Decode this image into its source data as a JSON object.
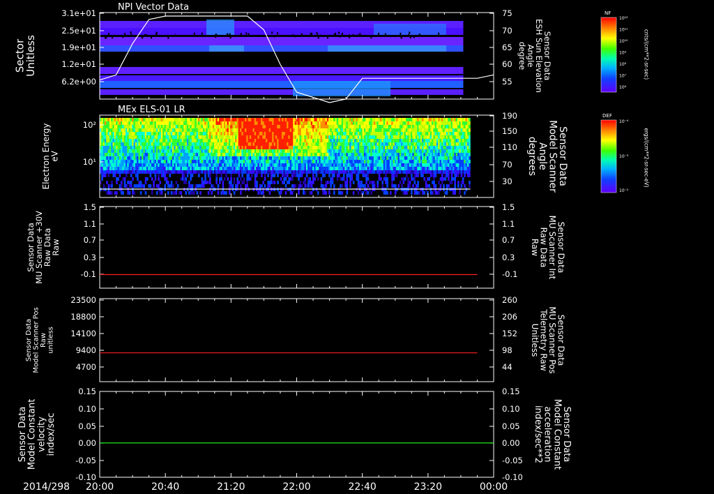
{
  "chart_data": [
    {
      "type": "heatmap",
      "title": "NPI Vector Data",
      "ylabel": "Sector Unitless",
      "yticks": [
        "3.1e+01",
        "2.5e+01",
        "1.9e+01",
        "1.2e+01",
        "6.2e+00"
      ],
      "right_ylabel": [
        "Sensor Data",
        "ESH Sun Elevation",
        "Angle",
        "degree"
      ],
      "right_yticks": [
        "75",
        "70",
        "65",
        "60",
        "55"
      ],
      "right_ylim": [
        50,
        75
      ],
      "colorbar": {
        "label": "NF",
        "units": "cnts/(cm**2-sr-sec)",
        "ticks": [
          "10¹²",
          "10¹¹",
          "10¹⁰",
          "10⁹",
          "10⁸",
          "10⁷",
          "10⁶"
        ]
      },
      "overlay_series": {
        "name": "ESH Sun Elevation Angle",
        "color": "#ffffff",
        "x": [
          "20:00",
          "20:10",
          "20:20",
          "20:30",
          "20:40",
          "20:50",
          "21:10",
          "21:30",
          "21:40",
          "21:50",
          "22:00",
          "22:20",
          "22:30",
          "22:40",
          "23:00",
          "23:30",
          "23:50",
          "24:00"
        ],
        "y": [
          55.5,
          57,
          66,
          73,
          74,
          74,
          74,
          74,
          70,
          60,
          52,
          49,
          50,
          56,
          56,
          56,
          56,
          57
        ]
      }
    },
    {
      "type": "heatmap",
      "title": "MEx ELS-01 LR",
      "ylabel": "Electron Energy eV",
      "yticks": [
        "10²",
        "10¹"
      ],
      "right_ylabel": [
        "Sensor Data",
        "Model Scanner",
        "Angle",
        "degrees"
      ],
      "right_yticks": [
        "190",
        "150",
        "110",
        "70",
        "30"
      ],
      "right_ylim": [
        0,
        190
      ],
      "colorbar": {
        "label": "DEF",
        "units": "ergs/(cm**2-sr-sec-eV)",
        "ticks": [
          "10⁻²",
          "10⁻³",
          "10⁻⁴"
        ]
      },
      "overlay_series": {
        "name": "Model Scanner Angle",
        "color": "#ffffff",
        "x": [
          "20:00",
          "23:50"
        ],
        "y": [
          10,
          10
        ]
      }
    },
    {
      "type": "line",
      "ylabel": [
        "Sensor Data",
        "MU Scanner +30V",
        "Raw Data",
        "Raw"
      ],
      "yticks": [
        "1.5",
        "1.1",
        "0.7",
        "0.3",
        "-0.1"
      ],
      "ylim": [
        -0.3,
        1.5
      ],
      "right_ylabel": [
        "Sensor Data",
        "MU Scanner Int",
        "Raw Data",
        "Raw"
      ],
      "right_yticks": [
        "1.5",
        "1.1",
        "0.7",
        "0.3",
        "-0.1"
      ],
      "series": [
        {
          "color": "#ff2020",
          "x": [
            "20:00",
            "23:50"
          ],
          "y": [
            0.0,
            0.0
          ]
        }
      ]
    },
    {
      "type": "line",
      "ylabel": [
        "Sensor Data",
        "Model Scanner Pos",
        "Raw",
        "unitless"
      ],
      "yticks": [
        "23500",
        "18800",
        "14100",
        "9400",
        "4700"
      ],
      "ylim": [
        0,
        23500
      ],
      "right_ylabel": [
        "Sensor Data",
        "MU Scanner Pos",
        "Telemetry Raw",
        "Unitless"
      ],
      "right_yticks": [
        "260",
        "206",
        "152",
        "98",
        "44"
      ],
      "series": [
        {
          "color": "#ff2020",
          "x": [
            "20:00",
            "23:50"
          ],
          "y": [
            8150,
            8150
          ]
        }
      ]
    },
    {
      "type": "line",
      "ylabel": [
        "Sensor Data",
        "Model Constant",
        "velocity",
        "index/sec"
      ],
      "yticks": [
        "0.15",
        "0.10",
        "0.05",
        "0.00",
        "-0.05",
        "-0.10"
      ],
      "ylim": [
        -0.1,
        0.15
      ],
      "right_ylabel": [
        "Sensor Data",
        "Model Constant",
        "acceleration",
        "index/sec**2"
      ],
      "right_yticks": [
        "0.15",
        "0.10",
        "0.05",
        "0.00",
        "-0.05",
        "-0.10"
      ],
      "series": [
        {
          "color": "#20ff20",
          "x": [
            "20:00",
            "24:00"
          ],
          "y": [
            0.0,
            0.0
          ]
        }
      ]
    }
  ],
  "xaxis": {
    "date_label": "2014/298",
    "ticks": [
      "20:00",
      "20:40",
      "21:20",
      "22:00",
      "22:40",
      "23:20",
      "00:00"
    ]
  },
  "colors": {
    "left_label": "#ffffff",
    "right_label_red": "#ff2020",
    "right_label_green": "#20ff20"
  }
}
